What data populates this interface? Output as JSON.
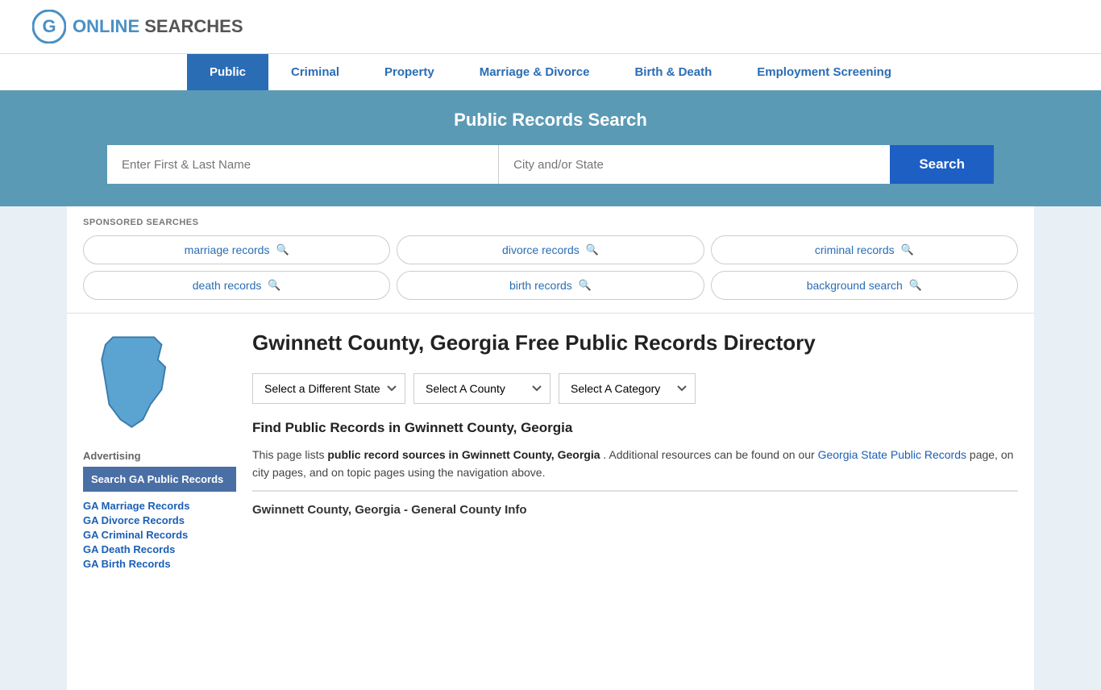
{
  "logo": {
    "text_online": "ONLINE",
    "text_searches": "SEARCHES"
  },
  "nav": {
    "items": [
      {
        "label": "Public",
        "active": true
      },
      {
        "label": "Criminal",
        "active": false
      },
      {
        "label": "Property",
        "active": false
      },
      {
        "label": "Marriage & Divorce",
        "active": false
      },
      {
        "label": "Birth & Death",
        "active": false
      },
      {
        "label": "Employment Screening",
        "active": false
      }
    ]
  },
  "hero": {
    "title": "Public Records Search",
    "name_placeholder": "Enter First & Last Name",
    "location_placeholder": "City and/or State",
    "search_button": "Search"
  },
  "sponsored": {
    "label": "SPONSORED SEARCHES",
    "items": [
      {
        "label": "marriage records"
      },
      {
        "label": "divorce records"
      },
      {
        "label": "criminal records"
      },
      {
        "label": "death records"
      },
      {
        "label": "birth records"
      },
      {
        "label": "background search"
      }
    ]
  },
  "sidebar": {
    "advertising_label": "Advertising",
    "ad_box_text": "Search GA Public Records",
    "links": [
      "GA Marriage Records",
      "GA Divorce Records",
      "GA Criminal Records",
      "GA Death Records",
      "GA Birth Records"
    ]
  },
  "page": {
    "title": "Gwinnett County, Georgia Free Public Records Directory",
    "dropdowns": {
      "state": "Select a Different State",
      "county": "Select A County",
      "category": "Select A Category"
    },
    "find_title": "Find Public Records in Gwinnett County, Georgia",
    "find_text_1": "This page lists ",
    "find_text_bold": "public record sources in Gwinnett County, Georgia",
    "find_text_2": ". Additional resources can be found on our ",
    "find_link": "Georgia State Public Records",
    "find_text_3": " page, on city pages, and on topic pages using the navigation above.",
    "bottom_title": "Gwinnett County, Georgia - General County Info"
  }
}
